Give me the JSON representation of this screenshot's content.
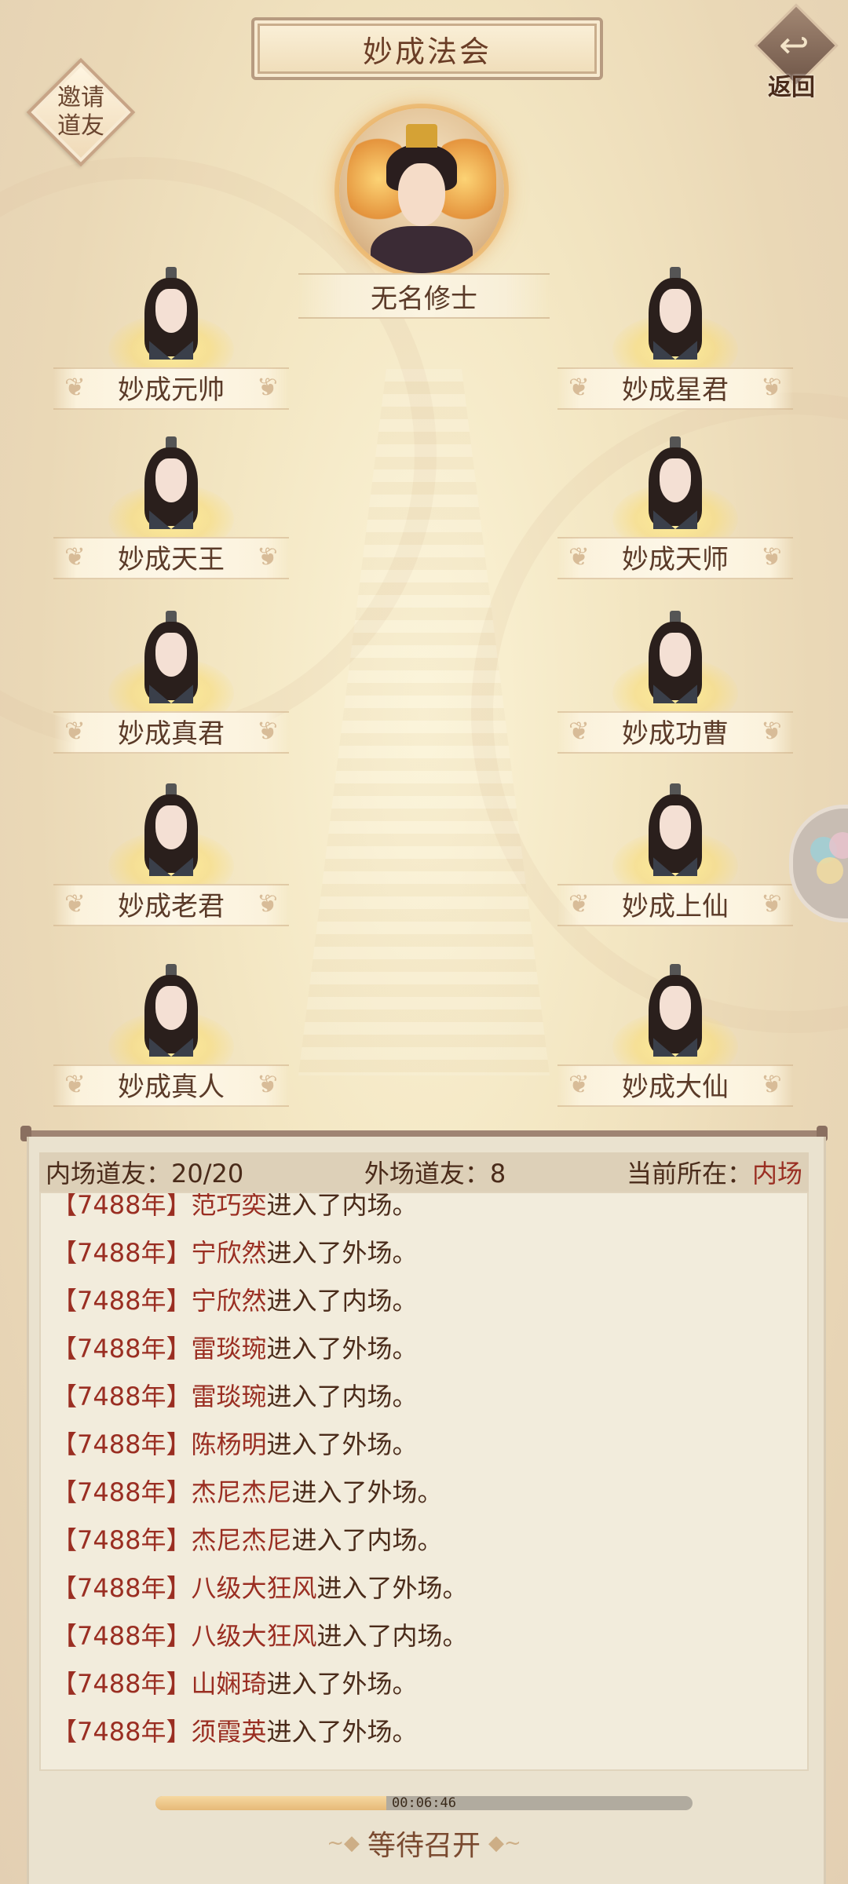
{
  "header": {
    "title": "妙成法会",
    "invite_label_1": "邀请",
    "invite_label_2": "道友",
    "back_label": "返回",
    "back_icon": "back-arrow-icon"
  },
  "host": {
    "name": "无名修士"
  },
  "seats": [
    {
      "name": "妙成元帅"
    },
    {
      "name": "妙成星君"
    },
    {
      "name": "妙成天王"
    },
    {
      "name": "妙成天师"
    },
    {
      "name": "妙成真君"
    },
    {
      "name": "妙成功曹"
    },
    {
      "name": "妙成老君"
    },
    {
      "name": "妙成上仙"
    },
    {
      "name": "妙成真人"
    },
    {
      "name": "妙成大仙"
    }
  ],
  "stats": {
    "inner_label": "内场道友：",
    "inner_value": "20/20",
    "outer_label": "外场道友：",
    "outer_value": "8",
    "location_label": "当前所在：",
    "location_value": "内场"
  },
  "log": [
    {
      "year": "【7488年】",
      "who": "范巧奕",
      "action": "进入了内场。"
    },
    {
      "year": "【7488年】",
      "who": "宁欣然",
      "action": "进入了外场。"
    },
    {
      "year": "【7488年】",
      "who": "宁欣然",
      "action": "进入了内场。"
    },
    {
      "year": "【7488年】",
      "who": "雷琰琬",
      "action": "进入了外场。"
    },
    {
      "year": "【7488年】",
      "who": "雷琰琬",
      "action": "进入了内场。"
    },
    {
      "year": "【7488年】",
      "who": "陈杨明",
      "action": "进入了外场。"
    },
    {
      "year": "【7488年】",
      "who": "杰尼杰尼",
      "action": "进入了外场。"
    },
    {
      "year": "【7488年】",
      "who": "杰尼杰尼",
      "action": "进入了内场。"
    },
    {
      "year": "【7488年】",
      "who": "八级大狂风",
      "action": "进入了外场。"
    },
    {
      "year": "【7488年】",
      "who": "八级大狂风",
      "action": "进入了内场。"
    },
    {
      "year": "【7488年】",
      "who": "山娴琦",
      "action": "进入了外场。"
    },
    {
      "year": "【7488年】",
      "who": "须霞英",
      "action": "进入了外场。"
    }
  ],
  "progress": {
    "time": "00:06:46",
    "fraction": 0.43
  },
  "status": {
    "label": "等待召开"
  },
  "colors": {
    "accent_red": "#9a2e22",
    "text_brown": "#4a2b1a"
  }
}
